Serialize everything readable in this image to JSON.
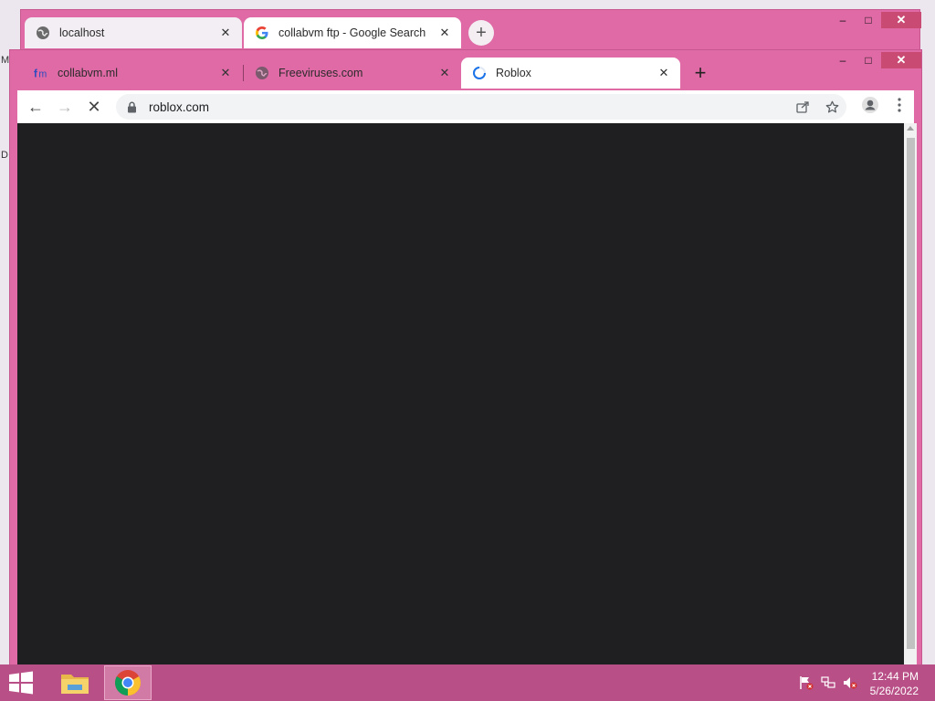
{
  "desktop": {
    "edge_letters": [
      "M",
      "D"
    ]
  },
  "back_window": {
    "tabs": [
      {
        "title": "localhost",
        "icon": "globe-icon"
      },
      {
        "title": "collabvm ftp - Google Search",
        "icon": "google-icon"
      }
    ],
    "new_tab_label": "+",
    "controls": {
      "minimize": "–",
      "maximize": "□",
      "close": "✕"
    }
  },
  "front_window": {
    "tabs": [
      {
        "title": "collabvm.ml",
        "icon": "collabvm-icon"
      },
      {
        "title": "Freeviruses.com",
        "icon": "globe-icon"
      },
      {
        "title": "Roblox",
        "icon": "loading-spinner-icon",
        "active": true
      }
    ],
    "new_tab_label": "+",
    "controls": {
      "minimize": "–",
      "maximize": "□",
      "close": "✕"
    },
    "toolbar": {
      "back": "←",
      "forward": "→",
      "stop": "✕",
      "url": "roblox.com",
      "share_icon": "share-icon",
      "bookmark_icon": "star-icon",
      "profile_icon": "profile-icon",
      "menu_icon": "kebab-menu-icon"
    },
    "viewport_color": "#1f1f21"
  },
  "taskbar": {
    "apps": [
      "file-explorer-icon",
      "chrome-icon"
    ],
    "clock": {
      "time": "12:44 PM",
      "date": "5/26/2022"
    },
    "accent": "#b84f86"
  }
}
